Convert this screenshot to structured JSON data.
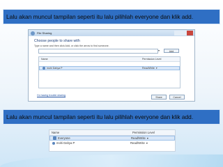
{
  "banner1": {
    "text": "Lalu akan muncul tampilan seperti itu  lalu pilihlah everyone dan klik add."
  },
  "dialog": {
    "title": "File Sharing",
    "heading": "Choose people to share with",
    "instructions": "Type a name and then click Add, or click the arrow to find someone.",
    "add_label": "Add",
    "table": {
      "columns": [
        "Name",
        "Permission Level"
      ],
      "rows": [
        {
          "name": "",
          "permission": ""
        },
        {
          "name": "mohi Dahya P",
          "permission": "Read/Write"
        }
      ]
    },
    "trouble_link": "I'm having trouble sharing",
    "share_label": "Share",
    "cancel_label": "Cancel"
  },
  "banner2": {
    "text": "Lalu akan muncul tampilan seperti itu  lalu pilihlah everyone dan klik add."
  },
  "zoom_table": {
    "columns": [
      "Name",
      "Permission Level"
    ],
    "rows": [
      {
        "name": "Everyone",
        "permission": "Read/Write"
      },
      {
        "name": "mohi Dahya P",
        "permission": "Read/Write"
      }
    ]
  },
  "icons": {
    "back": "back-arrow-icon",
    "user": "user-icon",
    "group": "group-icon",
    "dropdown": "chevron-down-icon"
  },
  "colors": {
    "banner": "#2f6fc4",
    "link": "#1f4fa0"
  }
}
